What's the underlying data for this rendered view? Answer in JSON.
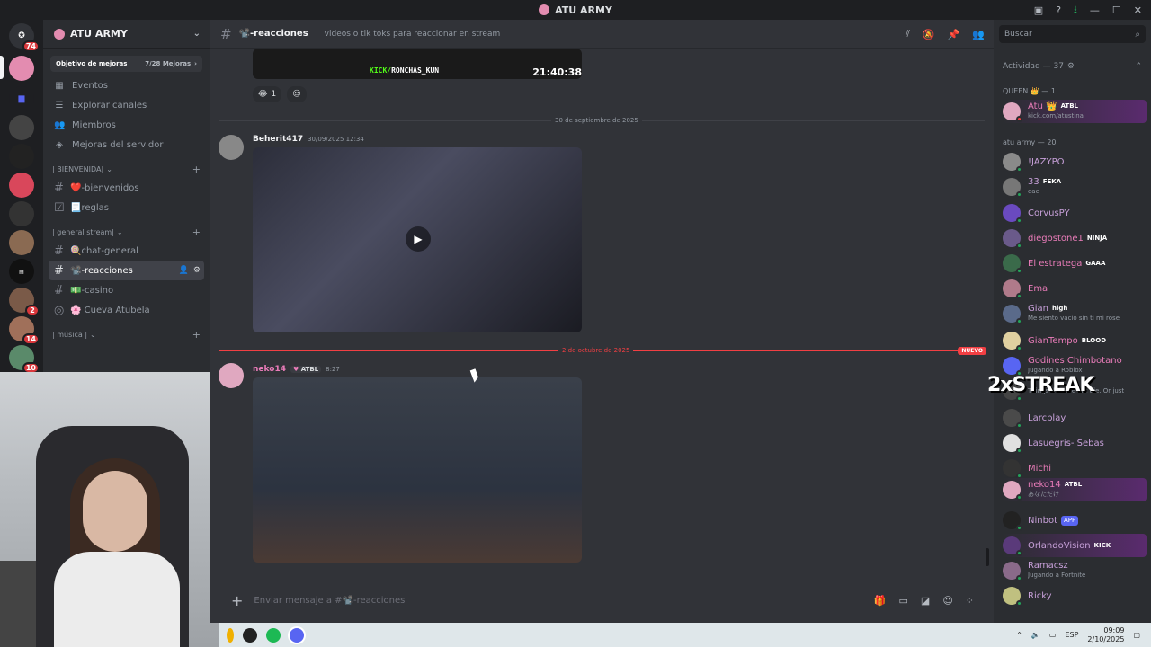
{
  "window": {
    "title": "ATU ARMY"
  },
  "guilds": {
    "badges": [
      "74",
      "2",
      "14",
      "10"
    ]
  },
  "server": {
    "name": "ATU ARMY",
    "boost_label": "Objetivo de mejoras",
    "boost_progress": "7/28 Mejoras",
    "nav": [
      {
        "label": "Eventos",
        "icon": "calendar-icon"
      },
      {
        "label": "Explorar canales",
        "icon": "list-icon"
      },
      {
        "label": "Miembros",
        "icon": "members-icon"
      },
      {
        "label": "Mejoras del servidor",
        "icon": "boost-icon"
      }
    ],
    "categories": {
      "bienvenida": "| BIENVENIDA|",
      "general": "| general stream|",
      "musica": "| música |"
    },
    "channels": [
      {
        "label": "❤️-bienvenidos"
      },
      {
        "label": "📃reglas"
      },
      {
        "label": "🍭chat-general"
      },
      {
        "label": "📽️-reacciones"
      },
      {
        "label": "💵-casino"
      },
      {
        "label": "🌸 Cueva Atubela"
      }
    ]
  },
  "channel": {
    "name": "📽️-reacciones",
    "topic": "videos o tik toks para reaccionar en stream"
  },
  "messages": {
    "video1": {
      "kick_prefix": "KICK/",
      "kick_user": "RONCHAS_KUN",
      "time": "21:40:38"
    },
    "reaction_count": "1",
    "date1": "30 de septiembre de 2025",
    "msg1": {
      "author": "Beherit417",
      "timestamp": "30/09/2025 12:34"
    },
    "date2": "2 de octubre de 2025",
    "new_label": "NUEVO",
    "msg2": {
      "author": "neko14",
      "tag": "ATBL",
      "timestamp": "8:27"
    }
  },
  "composer": {
    "placeholder": "Enviar mensaje a #📽️-reacciones"
  },
  "members": {
    "search_placeholder": "Buscar",
    "activity_header": "Actividad — 37",
    "queen_header": "QUEEN 👑 — 1",
    "army_header": "atu army — 20",
    "queen": {
      "name": "Atu 👑",
      "badge": "ATBL",
      "sub": "kick.com/atustina"
    },
    "list": [
      {
        "name": "!JAZYPO",
        "badge": "",
        "sub": ""
      },
      {
        "name": "33",
        "badge": "FEKA",
        "sub": "eae"
      },
      {
        "name": "CorvusPY",
        "badge": "",
        "sub": ""
      },
      {
        "name": "diegostone1",
        "badge": "NINJA",
        "sub": ""
      },
      {
        "name": "El estratega",
        "badge": "GAAA",
        "sub": ""
      },
      {
        "name": "Ema",
        "badge": "",
        "sub": ""
      },
      {
        "name": "Gian",
        "badge": "high",
        "sub": "Me siento vacio sin ti mi rose"
      },
      {
        "name": "GianTempo",
        "badge": "BLOOD",
        "sub": ""
      },
      {
        "name": "Godines Chimbotano",
        "badge": "",
        "sub": "Jugando a Roblox"
      },
      {
        "name": "",
        "badge": "",
        "sub": "Things that are cut die. Or just"
      },
      {
        "name": "Larcplay",
        "badge": "",
        "sub": ""
      },
      {
        "name": "Lasuegris- Sebas",
        "badge": "",
        "sub": ""
      },
      {
        "name": "Michi",
        "badge": "",
        "sub": ""
      },
      {
        "name": "neko14",
        "badge": "ATBL",
        "sub": "あなただけ"
      },
      {
        "name": "Ninbot",
        "badge": "APP",
        "sub": ""
      },
      {
        "name": "OrlandoVision",
        "badge": "KICK",
        "sub": ""
      },
      {
        "name": "Ramacsz",
        "badge": "",
        "sub": "Jugando a Fortnite"
      },
      {
        "name": "Ricky",
        "badge": "",
        "sub": ""
      }
    ]
  },
  "overlay": {
    "streak": "2xSTREAK"
  },
  "taskbar": {
    "lang": "ESP",
    "time": "09:09",
    "date": "2/10/2025"
  }
}
